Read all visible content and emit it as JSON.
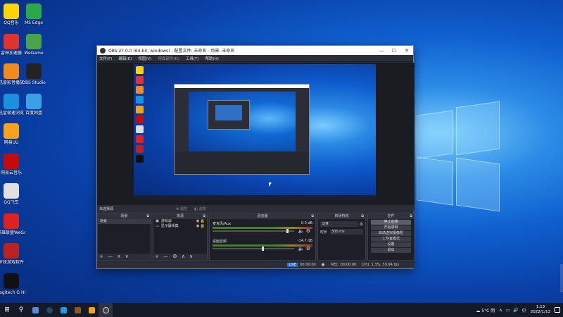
{
  "desktop": {
    "icons_col1": [
      {
        "label": "QQ音乐",
        "icon": "music-icon",
        "color": "#ffd400"
      },
      {
        "label": "雷神加速器",
        "icon": "boost-icon",
        "color": "#d33"
      },
      {
        "label": "迅雷影音播放",
        "icon": "player-icon",
        "color": "#f28b1e"
      },
      {
        "label": "迅雷极速浏览",
        "icon": "browser-icon",
        "color": "#1b8fe0"
      },
      {
        "label": "网易UU",
        "icon": "uu-icon",
        "color": "#f7a21b"
      },
      {
        "label": "网易云音乐",
        "icon": "netease-icon",
        "color": "#c20c0c"
      },
      {
        "label": "QQ飞车",
        "icon": "game-icon",
        "color": "#e0e0e0"
      },
      {
        "label": "英雄联盟WeGame",
        "icon": "wegame-icon",
        "color": "#d22"
      },
      {
        "label": "罗技游戏软件",
        "icon": "game-icon",
        "color": "#b22"
      },
      {
        "label": "Logitech G HUB",
        "icon": "logitech-icon",
        "color": "#111"
      }
    ],
    "icons_col2": [
      {
        "label": "MS Edge",
        "icon": "edge-icon",
        "color": "#2ba84a"
      },
      {
        "label": "WeGame",
        "icon": "wegame-icon",
        "color": "#4aa34a"
      },
      {
        "label": "OBS Studio",
        "icon": "obs-icon",
        "color": "#222"
      },
      {
        "label": "百度网盘",
        "icon": "cloud-icon",
        "color": "#3aa0e8"
      }
    ]
  },
  "obs": {
    "title": "OBS 27.0.0 (64-bit, windows) - 配置文件: 未命名 - 场景: 未命名",
    "menu": [
      "文件(F)",
      "编辑(E)",
      "视图(V)",
      "停靠部件(D)",
      "工具(T)",
      "帮助(H)"
    ],
    "dock_header": "未选择源",
    "dock_header_btns": [
      "属性",
      "滤镜"
    ],
    "scenes": {
      "title": "场景",
      "items": [
        "场景"
      ]
    },
    "sources": {
      "title": "来源",
      "items": [
        "显示器采集",
        "游戏源"
      ]
    },
    "mixer": {
      "title": "混音器",
      "tracks": [
        {
          "name": "麦克风/Aux",
          "db": "0.0 dB"
        },
        {
          "name": "桌面音频",
          "db": "-14.7 dB"
        }
      ]
    },
    "transitions": {
      "title": "转场特效",
      "type": "淡变",
      "duration_label": "时长",
      "duration": "300 ms"
    },
    "controls": {
      "title": "控件",
      "buttons": [
        "停止直播",
        "开始录制",
        "启动虚拟摄像机",
        "工作室模式",
        "设置",
        "退出"
      ],
      "active": 0
    },
    "status": {
      "live_badge": "LIVE",
      "live_time": "00:00:00",
      "rec_label": "REC",
      "rec_time": "00:00:00",
      "cpu": "CPU: 1.3%, 59.94 fps"
    }
  },
  "taskbar": {
    "weather": "5°C 阴",
    "time": "1:13",
    "date": "2022/1/13",
    "ime": "中"
  }
}
